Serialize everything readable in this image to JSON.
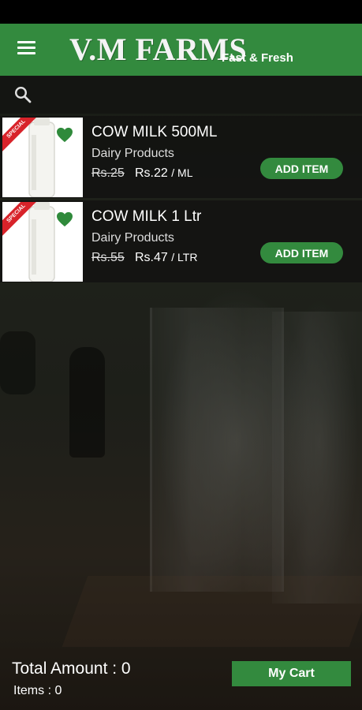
{
  "header": {
    "brand": "V.M FARMS",
    "tagline": "Fast & Fresh",
    "menu_icon": "menu-icon"
  },
  "search": {
    "icon": "search-icon"
  },
  "products": [
    {
      "title": "COW MILK 500ML",
      "category": "Dairy Products",
      "old_price": "Rs.25",
      "new_price": "Rs.22",
      "unit": "/ ML",
      "badge": "SPECIAL",
      "button": "ADD ITEM"
    },
    {
      "title": "COW MILK 1 Ltr",
      "category": "Dairy Products",
      "old_price": "Rs.55",
      "new_price": "Rs.47",
      "unit": "/ LTR",
      "badge": "SPECIAL",
      "button": "ADD ITEM"
    }
  ],
  "footer": {
    "total_amount": "Total Amount : 0",
    "items": "Items : 0",
    "cart_button": "My Cart"
  },
  "colors": {
    "accent": "#338a3e",
    "badge": "#d8232a"
  }
}
